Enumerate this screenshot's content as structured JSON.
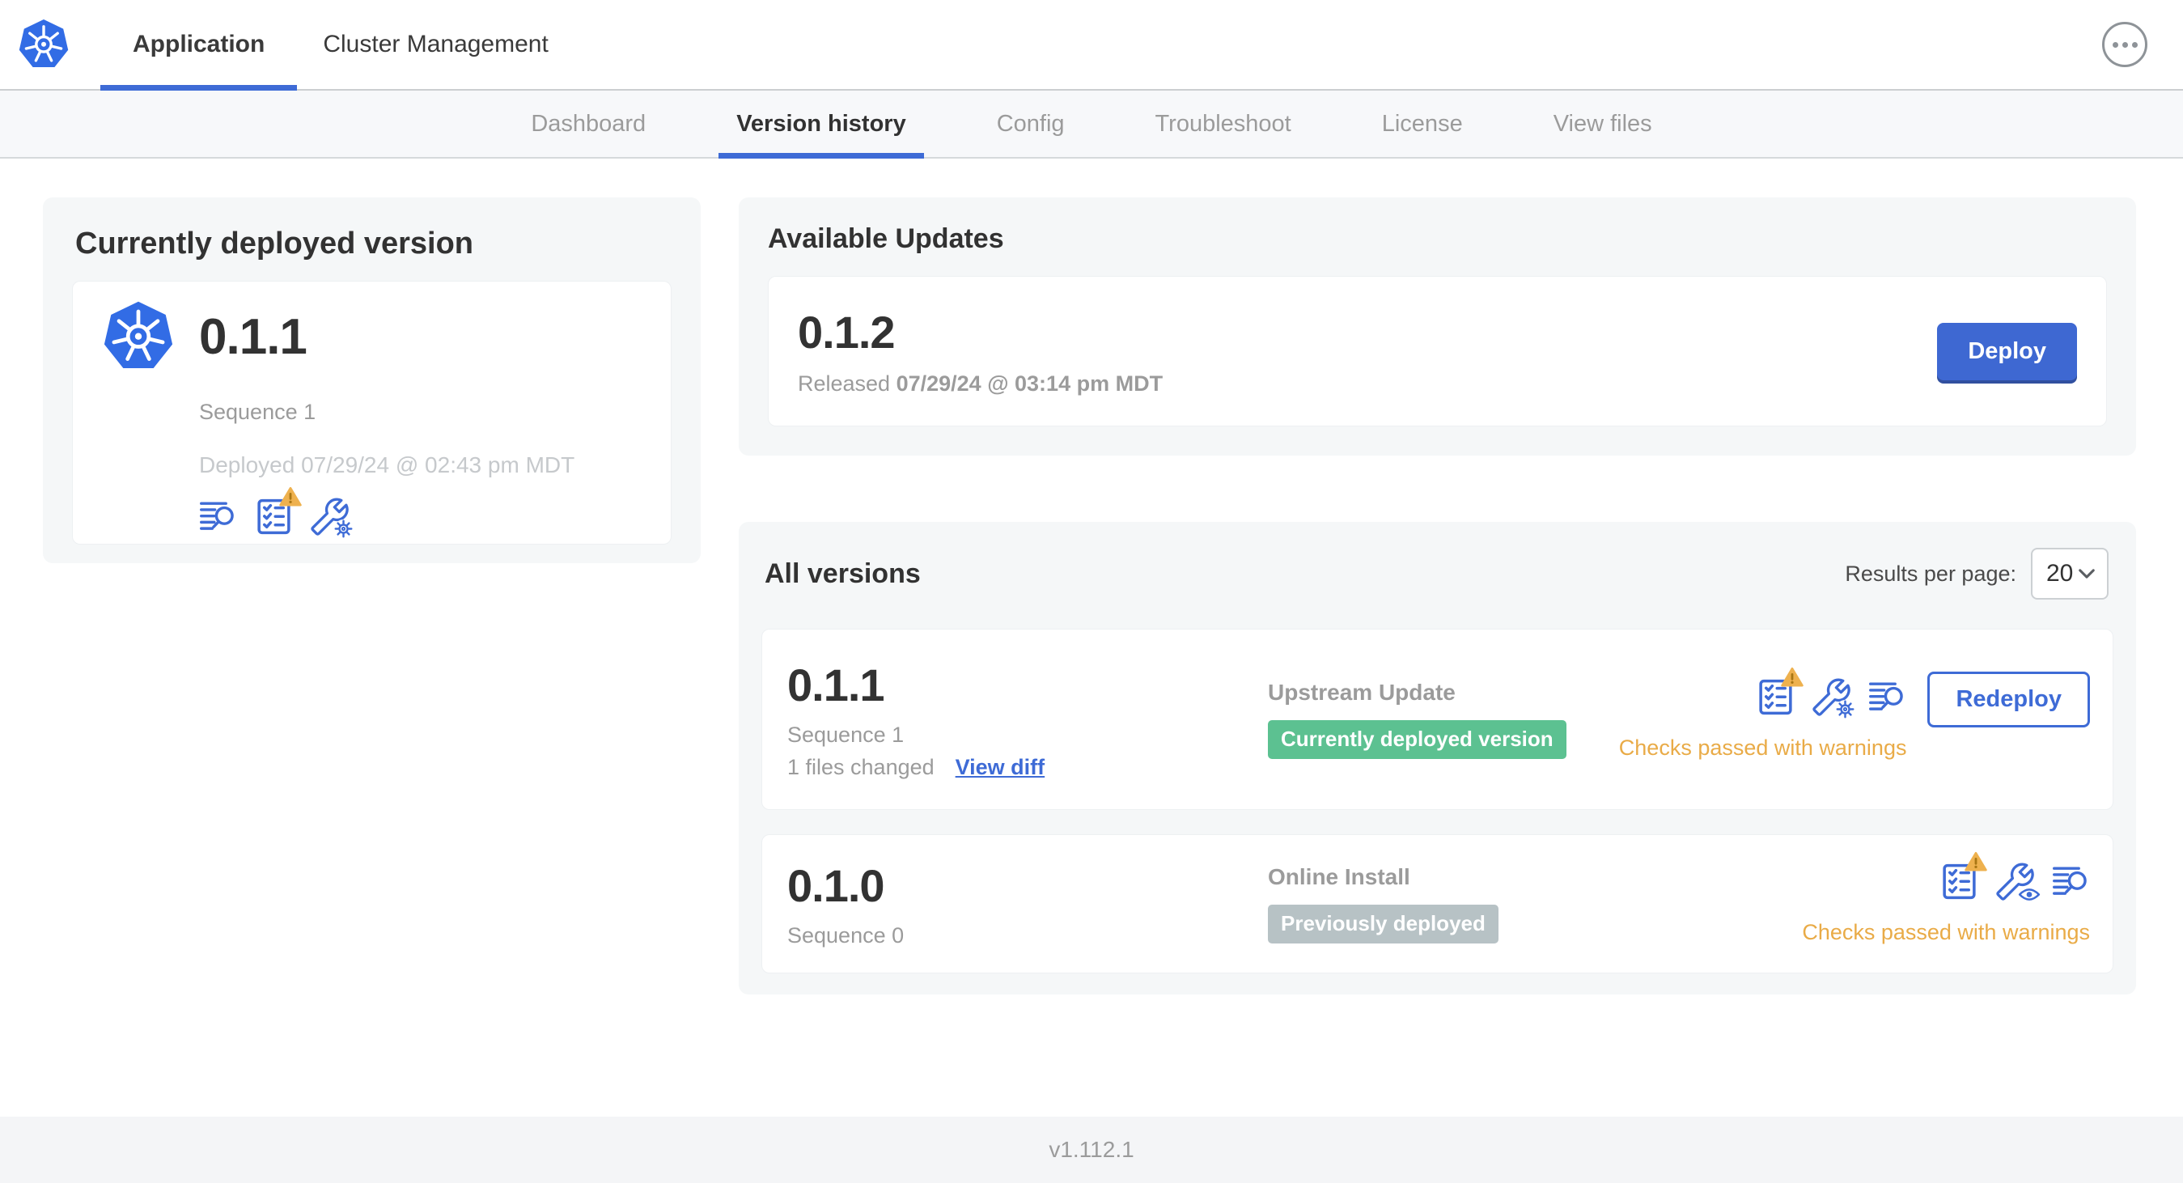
{
  "header": {
    "tabs": [
      {
        "label": "Application",
        "active": true
      },
      {
        "label": "Cluster Management",
        "active": false
      }
    ]
  },
  "subnav": {
    "tabs": [
      {
        "label": "Dashboard",
        "active": false
      },
      {
        "label": "Version history",
        "active": true
      },
      {
        "label": "Config",
        "active": false
      },
      {
        "label": "Troubleshoot",
        "active": false
      },
      {
        "label": "License",
        "active": false
      },
      {
        "label": "View files",
        "active": false
      }
    ]
  },
  "current": {
    "title": "Currently deployed version",
    "version": "0.1.1",
    "sequence": "Sequence 1",
    "deployed": "Deployed 07/29/24 @ 02:43 pm MDT"
  },
  "updates": {
    "title": "Available Updates",
    "version": "0.1.2",
    "released_prefix": "Released",
    "released_date": "07/29/24 @ 03:14 pm MDT",
    "deploy_label": "Deploy"
  },
  "all_versions": {
    "title": "All versions",
    "results_per_page_label": "Results per page:",
    "results_per_page_value": "20",
    "rows": [
      {
        "version": "0.1.1",
        "sequence": "Sequence 1",
        "files_changed": "1 files changed",
        "view_diff_label": "View diff",
        "source": "Upstream Update",
        "badge": "Currently deployed version",
        "badge_color": "#5cc191",
        "checks": "Checks passed with warnings",
        "action_label": "Redeploy"
      },
      {
        "version": "0.1.0",
        "sequence": "Sequence 0",
        "source": "Online Install",
        "badge": "Previously deployed",
        "badge_color": "#b7c2c5",
        "checks": "Checks passed with warnings"
      }
    ]
  },
  "footer": {
    "version": "v1.112.1"
  },
  "colors": {
    "accent_blue": "#3e6bd6",
    "kubernetes_blue": "#326ce5",
    "success_green": "#5cc191",
    "neutral_badge_gray": "#b7c2c5",
    "warning_orange": "#e9ab47",
    "card_background": "#f5f7f8",
    "muted_text": "#9b9b9b"
  },
  "icons": {
    "logo": "kubernetes-wheel-logo",
    "menu": "ellipsis-circle-icon",
    "release_notes": "document-search-icon",
    "preflight": "checklist-warning-icon",
    "config_edit": "wrench-gear-icon",
    "config_view": "wrench-eye-icon",
    "select_chevron": "chevron-down-icon"
  }
}
